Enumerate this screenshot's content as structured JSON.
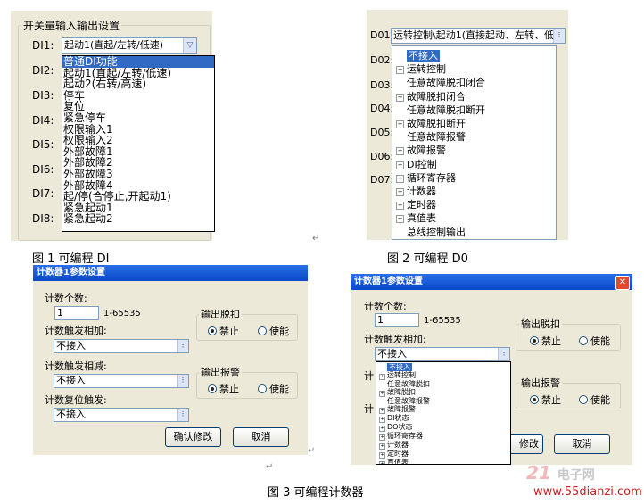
{
  "fig1": {
    "group_title": "开关量输入输出设置",
    "di_labels": [
      "DI1:",
      "DI2:",
      "DI3:",
      "DI4:",
      "DI5:",
      "DI6:",
      "DI7:",
      "DI8:"
    ],
    "combo_value": "起动1(直起/左转/低速)",
    "dropdown_items": [
      "普通DI功能",
      "起动1(直起/左转/低速)",
      "起动2(右转/高速)",
      "停车",
      "复位",
      "紧急停车",
      "权限输入1",
      "权限输入2",
      "外部故障1",
      "外部故障2",
      "外部故障3",
      "外部故障4",
      "起/停(合停止,开起动1)",
      "紧急起动1",
      "紧急起动2"
    ],
    "selected_index": 0,
    "caption": "图 1  可编程 DI"
  },
  "fig2": {
    "do_labels": [
      "D01:",
      "D02:",
      "D03:",
      "D04:",
      "D05:",
      "D06:",
      "D07:"
    ],
    "combo_value": "运转控制\\起动1(直接起动、左转、低",
    "tree_items": [
      {
        "label": "不接入",
        "expand": false,
        "indent": false,
        "selected": true
      },
      {
        "label": "运转控制",
        "expand": true,
        "indent": false,
        "selected": false
      },
      {
        "label": "任意故障脱扣闭合",
        "expand": false,
        "indent": false,
        "selected": false
      },
      {
        "label": "故障脱扣闭合",
        "expand": true,
        "indent": false,
        "selected": false
      },
      {
        "label": "任意故障脱扣断开",
        "expand": false,
        "indent": false,
        "selected": false
      },
      {
        "label": "故障脱扣断开",
        "expand": true,
        "indent": false,
        "selected": false
      },
      {
        "label": "任意故障报警",
        "expand": false,
        "indent": false,
        "selected": false
      },
      {
        "label": "故障报警",
        "expand": true,
        "indent": false,
        "selected": false
      },
      {
        "label": "DI控制",
        "expand": true,
        "indent": false,
        "selected": false
      },
      {
        "label": "循环寄存器",
        "expand": true,
        "indent": false,
        "selected": false
      },
      {
        "label": "计数器",
        "expand": true,
        "indent": false,
        "selected": false
      },
      {
        "label": "定时器",
        "expand": true,
        "indent": false,
        "selected": false
      },
      {
        "label": "真值表",
        "expand": true,
        "indent": false,
        "selected": false
      },
      {
        "label": "总线控制输出",
        "expand": false,
        "indent": false,
        "selected": false
      }
    ],
    "caption": "图 2    可编程 D0"
  },
  "fig3a": {
    "title": "计数器1参数设置",
    "count_label": "计数个数:",
    "count_value": "1",
    "count_range": "1-65535",
    "inc_label": "计数触发相加:",
    "inc_value": "不接入",
    "dec_label": "计数触发相减:",
    "dec_value": "不接入",
    "reset_label": "计数复位触发:",
    "reset_value": "不接入",
    "trip_group": "输出脱扣",
    "alarm_group": "输出报警",
    "disable": "禁止",
    "enable": "使能",
    "confirm": "确认修改",
    "cancel": "取消"
  },
  "fig3b": {
    "title": "计数器1参数设置",
    "count_label": "计数个数:",
    "count_value": "1",
    "count_range": "1-65535",
    "inc_label": "计数触发相加:",
    "inc_value": "不接入",
    "trip_group": "输出脱扣",
    "alarm_group": "输出报警",
    "disable": "禁止",
    "enable": "使能",
    "confirm_partial": "修改",
    "cancel": "取消",
    "partial_label_1": "计",
    "partial_label_2": "计",
    "tree_items": [
      {
        "label": "不接入",
        "expand": false,
        "selected": true
      },
      {
        "label": "运转控制",
        "expand": true,
        "selected": false
      },
      {
        "label": "任意故障脱扣",
        "expand": false,
        "selected": false
      },
      {
        "label": "故障脱扣",
        "expand": true,
        "selected": false
      },
      {
        "label": "任意故障报警",
        "expand": false,
        "selected": false
      },
      {
        "label": "故障报警",
        "expand": true,
        "selected": false
      },
      {
        "label": "DI状态",
        "expand": true,
        "selected": false
      },
      {
        "label": "DO状态",
        "expand": true,
        "selected": false
      },
      {
        "label": "循环寄存器",
        "expand": true,
        "selected": false
      },
      {
        "label": "计数器",
        "expand": true,
        "selected": false
      },
      {
        "label": "定时器",
        "expand": true,
        "selected": false
      },
      {
        "label": "真值表",
        "expand": true,
        "selected": false
      }
    ]
  },
  "caption3": "图 3   可编程计数器",
  "watermark_url": "www.55dianzi.com",
  "watermark_logo_text": "电子网",
  "return_marks": "↵"
}
